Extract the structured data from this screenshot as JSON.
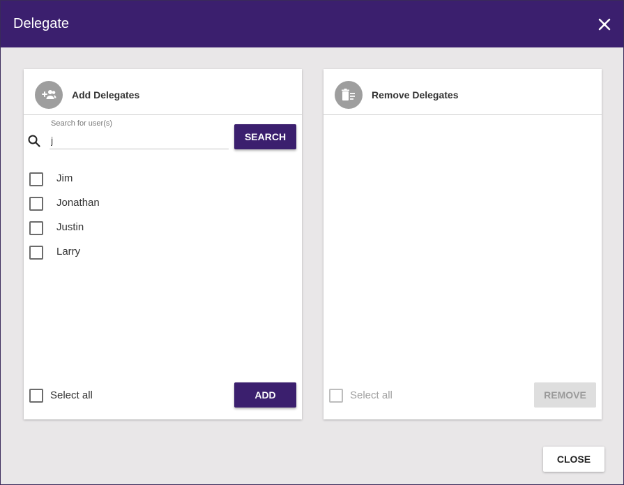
{
  "dialog": {
    "title": "Delegate",
    "close_label": "CLOSE"
  },
  "add_panel": {
    "title": "Add Delegates",
    "icon": "group-add-icon",
    "search": {
      "label": "Search for user(s)",
      "value": "j",
      "button_label": "SEARCH"
    },
    "users": [
      {
        "name": "Jim",
        "checked": false
      },
      {
        "name": "Jonathan",
        "checked": false
      },
      {
        "name": "Justin",
        "checked": false
      },
      {
        "name": "Larry",
        "checked": false
      }
    ],
    "select_all_label": "Select all",
    "add_button_label": "ADD"
  },
  "remove_panel": {
    "title": "Remove Delegates",
    "icon": "delete-list-icon",
    "select_all_label": "Select all",
    "remove_button_label": "REMOVE"
  },
  "colors": {
    "primary": "#3b1f6e",
    "disabled": "#dedede"
  }
}
